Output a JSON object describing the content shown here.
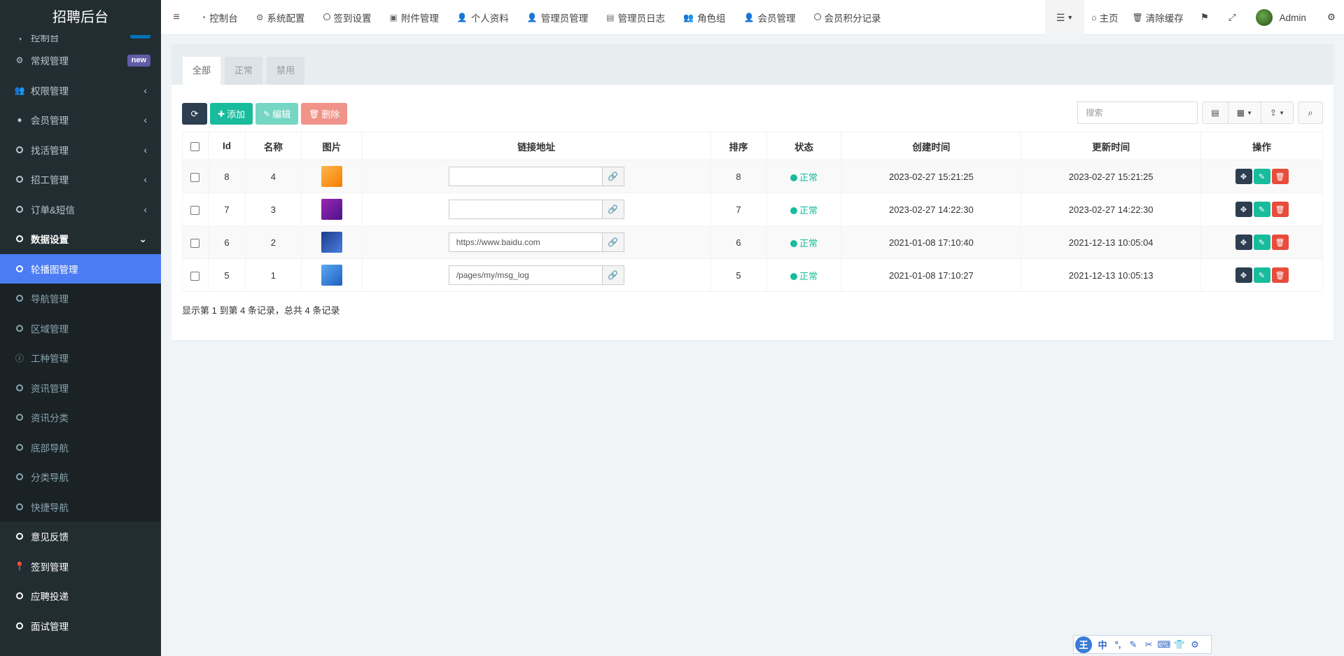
{
  "brand": "招聘后台",
  "sidebar": {
    "items": [
      {
        "label": "控制台",
        "badge": "hot"
      },
      {
        "label": "常规管理",
        "badge": "new"
      },
      {
        "label": "权限管理"
      },
      {
        "label": "会员管理"
      },
      {
        "label": "找活管理"
      },
      {
        "label": "招工管理"
      },
      {
        "label": "订单&短信"
      },
      {
        "label": "数据设置"
      },
      {
        "label": "轮播图管理"
      },
      {
        "label": "导航管理"
      },
      {
        "label": "区域管理"
      },
      {
        "label": "工种管理"
      },
      {
        "label": "资讯管理"
      },
      {
        "label": "资讯分类"
      },
      {
        "label": "底部导航"
      },
      {
        "label": "分类导航"
      },
      {
        "label": "快捷导航"
      },
      {
        "label": "意见反馈"
      },
      {
        "label": "签到管理"
      },
      {
        "label": "应聘投递"
      },
      {
        "label": "面试管理"
      }
    ]
  },
  "navbar": {
    "tabs": [
      "控制台",
      "系统配置",
      "签到设置",
      "附件管理",
      "个人资料",
      "管理员管理",
      "管理员日志",
      "角色组",
      "会员管理",
      "会员积分记录"
    ],
    "home": "主页",
    "clear_cache": "清除缓存",
    "user": "Admin"
  },
  "filter_tabs": [
    "全部",
    "正常",
    "禁用"
  ],
  "toolbar": {
    "add": "添加",
    "edit": "编辑",
    "delete": "删除"
  },
  "search": {
    "placeholder": "搜索"
  },
  "table": {
    "headers": [
      "Id",
      "名称",
      "图片",
      "链接地址",
      "排序",
      "状态",
      "创建时间",
      "更新时间",
      "操作"
    ],
    "rows": [
      {
        "id": "8",
        "name": "4",
        "link": "",
        "sort": "8",
        "status": "正常",
        "created": "2023-02-27 15:21:25",
        "updated": "2023-02-27 15:21:25",
        "thumb_color": "#f5a623"
      },
      {
        "id": "7",
        "name": "3",
        "link": "",
        "sort": "7",
        "status": "正常",
        "created": "2023-02-27 14:22:30",
        "updated": "2023-02-27 14:22:30",
        "thumb_color": "#7b2fbe"
      },
      {
        "id": "6",
        "name": "2",
        "link": "https://www.baidu.com",
        "sort": "6",
        "status": "正常",
        "created": "2021-01-08 17:10:40",
        "updated": "2021-12-13 10:05:04",
        "thumb_color": "#2f6fd6"
      },
      {
        "id": "5",
        "name": "1",
        "link": "/pages/my/msg_log",
        "sort": "5",
        "status": "正常",
        "created": "2021-01-08 17:10:27",
        "updated": "2021-12-13 10:05:13",
        "thumb_color": "#3c8ee8"
      }
    ]
  },
  "pager_text": "显示第 1 到第 4 条记录，总共 4 条记录",
  "ime": {
    "logo": "王",
    "lang": "中"
  }
}
